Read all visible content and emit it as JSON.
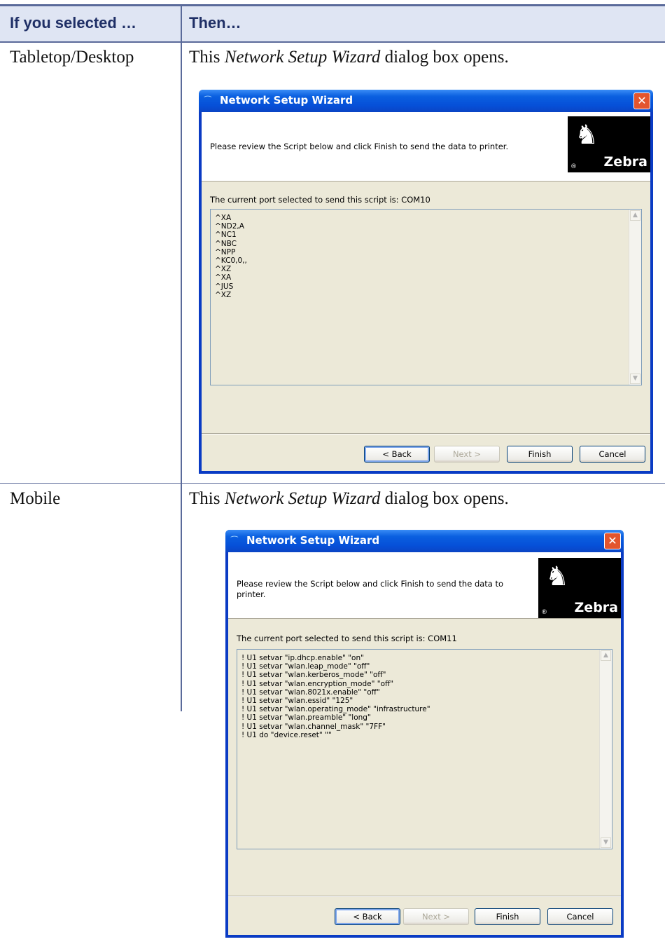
{
  "table": {
    "header_col1": "If you selected …",
    "header_col2": "Then…"
  },
  "rows": [
    {
      "selection": "Tabletop/Desktop",
      "desc_prefix": "This ",
      "desc_em": "Network Setup Wizard",
      "desc_suffix": " dialog box opens.",
      "dialog": {
        "title": "Network Setup Wizard",
        "instruction": "Please review the Script below and click Finish to send the data to printer.",
        "logo_text": "Zebra",
        "port_label": "The current port selected to send this script is: COM10",
        "script": "^XA\n^ND2,A\n^NC1\n^NBC\n^NPP\n^KC0,0,,\n^XZ\n^XA\n^JUS\n^XZ",
        "buttons": {
          "back": "< Back",
          "next": "Next >",
          "finish": "Finish",
          "cancel": "Cancel"
        }
      }
    },
    {
      "selection": "Mobile",
      "desc_prefix": "This ",
      "desc_em": "Network Setup Wizard",
      "desc_suffix": " dialog box opens.",
      "dialog": {
        "title": "Network Setup Wizard",
        "instruction": "Please review the Script below and click Finish to send the data to printer.",
        "logo_text": "Zebra",
        "port_label": "The current port selected to send this script is: COM11",
        "script": "! U1 setvar \"ip.dhcp.enable\" \"on\"\n! U1 setvar \"wlan.leap_mode\" \"off\"\n! U1 setvar \"wlan.kerberos_mode\" \"off\"\n! U1 setvar \"wlan.encryption_mode\" \"off\"\n! U1 setvar \"wlan.8021x.enable\" \"off\"\n! U1 setvar \"wlan.essid\" \"125\"\n! U1 setvar \"wlan.operating_mode\" \"infrastructure\"\n! U1 setvar \"wlan.preamble\" \"long\"\n! U1 setvar \"wlan.channel_mask\" \"7FF\"\n! U1 do \"device.reset\" \"\"",
        "buttons": {
          "back": "< Back",
          "next": "Next >",
          "finish": "Finish",
          "cancel": "Cancel"
        }
      }
    }
  ]
}
